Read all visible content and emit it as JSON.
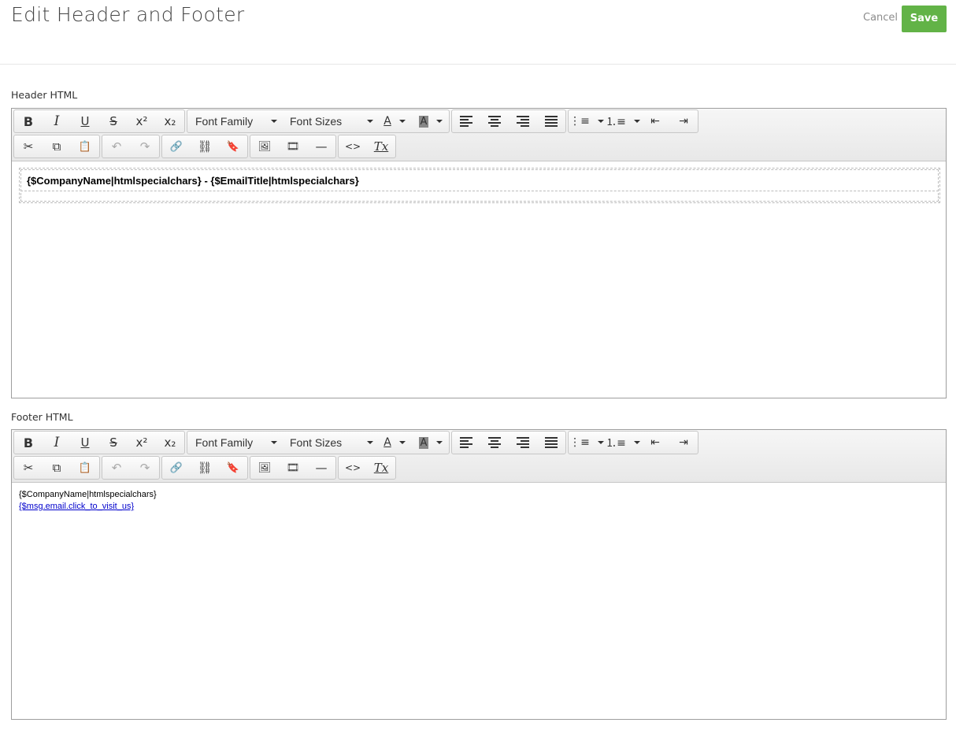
{
  "page": {
    "title": "Edit Header and Footer",
    "cancel_label": "Cancel",
    "save_label": "Save"
  },
  "header_section": {
    "label": "Header HTML",
    "content_text": "{$CompanyName|htmlspecialchars} - {$EmailTitle|htmlspecialchars}"
  },
  "footer_section": {
    "label": "Footer HTML",
    "line1": "{$CompanyName|htmlspecialchars}",
    "link_text": "{$msg.email.click_to_visit_us}"
  },
  "toolbar": {
    "font_family": "Font Family",
    "font_sizes": "Font Sizes",
    "bold": "B",
    "italic": "I",
    "underline": "U",
    "strike": "S",
    "superscript": "x²",
    "subscript": "x₂",
    "text_color": "A",
    "bg_color": "A",
    "cut": "✂",
    "copy": "⧉",
    "paste": "📋",
    "undo": "↶",
    "redo": "↷",
    "link": "🔗",
    "unlink": "⛓",
    "anchor": "🔖",
    "image": "🖼",
    "media": "🎞",
    "hr": "—",
    "code": "<>",
    "clear_format": "Tx"
  },
  "colors": {
    "save_button": "#62b347",
    "link": "#0000cc"
  }
}
